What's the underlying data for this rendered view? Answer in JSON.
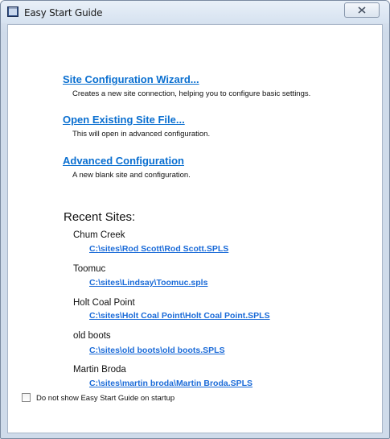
{
  "window": {
    "title": "Easy Start Guide",
    "close_icon": "close-x-icon",
    "app_icon": "window-icon"
  },
  "actions": [
    {
      "label": "Site Configuration Wizard...",
      "description": "Creates a new site connection, helping you to configure basic settings."
    },
    {
      "label": "Open Existing Site File...",
      "description": "This will open in advanced configuration."
    },
    {
      "label": "Advanced Configuration",
      "description": "A new blank site and configuration."
    }
  ],
  "recent": {
    "heading": "Recent Sites:",
    "sites": [
      {
        "name": "Chum Creek",
        "path": "C:\\sites\\Rod Scott\\Rod Scott.SPLS"
      },
      {
        "name": "Toomuc",
        "path": "C:\\sites\\Lindsay\\Toomuc.spls"
      },
      {
        "name": "Holt Coal Point",
        "path": "C:\\sites\\Holt Coal Point\\Holt Coal Point.SPLS"
      },
      {
        "name": "old boots",
        "path": "C:\\sites\\old boots\\old boots.SPLS"
      },
      {
        "name": "Martin Broda",
        "path": "C:\\sites\\martin broda\\Martin Broda.SPLS"
      }
    ]
  },
  "footer": {
    "checkbox_label": "Do not show Easy Start Guide on startup",
    "checked": false
  },
  "colors": {
    "link": "#0a6fd0",
    "path_link": "#1b6bd8"
  }
}
